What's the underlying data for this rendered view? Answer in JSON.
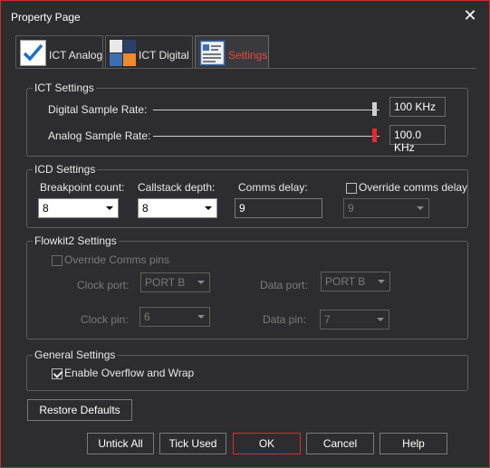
{
  "window": {
    "title": "Property Page"
  },
  "tabs": [
    {
      "label": "ICT Analog"
    },
    {
      "label": "ICT Digital"
    },
    {
      "label": "Settings"
    }
  ],
  "ict_settings": {
    "title": "ICT Settings",
    "digital_label": "Digital Sample Rate:",
    "digital_value": "100 KHz",
    "analog_label": "Analog Sample Rate:",
    "analog_value": "100.0 KHz"
  },
  "icd_settings": {
    "title": "ICD Settings",
    "breakpoint_label": "Breakpoint count:",
    "breakpoint_value": "8",
    "callstack_label": "Callstack depth:",
    "callstack_value": "8",
    "comms_label": "Comms delay:",
    "comms_value": "9",
    "override_label": "Override comms delay",
    "override_value": "9"
  },
  "flowkit2": {
    "title": "Flowkit2 Settings",
    "override_label": "Override Comms pins",
    "clock_port_label": "Clock port:",
    "clock_port_value": "PORT B",
    "data_port_label": "Data port:",
    "data_port_value": "PORT B",
    "clock_pin_label": "Clock pin:",
    "clock_pin_value": "6",
    "data_pin_label": "Data pin:",
    "data_pin_value": "7"
  },
  "general": {
    "title": "General Settings",
    "overflow_label": "Enable Overflow and Wrap"
  },
  "buttons": {
    "restore": "Restore Defaults",
    "untick": "Untick All",
    "tick": "Tick Used",
    "ok": "OK",
    "cancel": "Cancel",
    "help": "Help"
  }
}
